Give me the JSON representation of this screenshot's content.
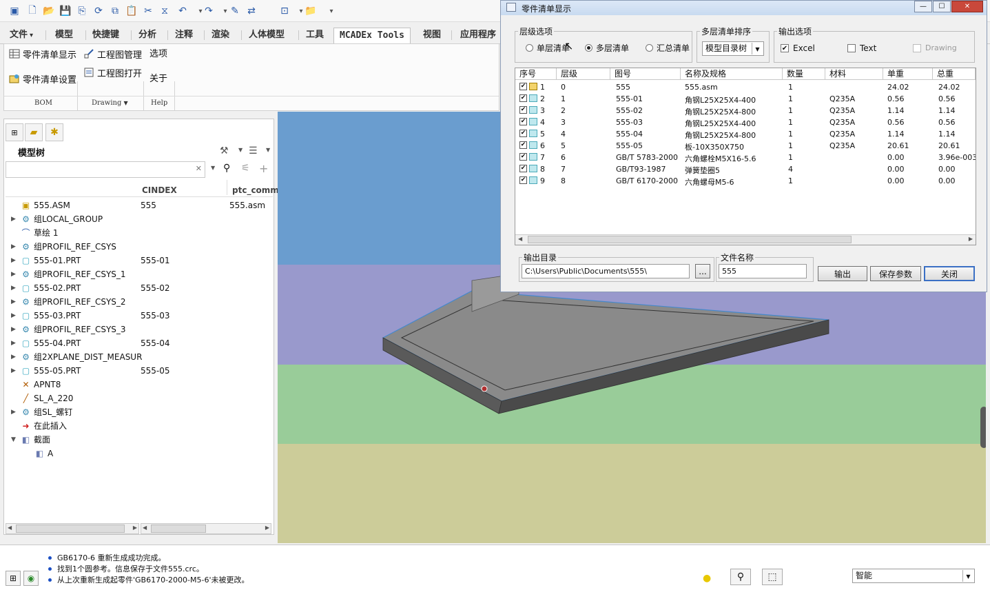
{
  "quick_access": {
    "icons": [
      "app-icon",
      "new-icon",
      "open-icon",
      "save-icon",
      "save-as-icon",
      "regenerate-icon",
      "copy-icon",
      "paste-icon",
      "cut-icon",
      "mirror-icon",
      "undo-icon",
      "undo-dropdown-icon",
      "redo-icon",
      "redo-dropdown-icon",
      "edit-icon",
      "relations-icon",
      "window-icon",
      "window-dropdown-icon",
      "folder-icon",
      "customize-icon"
    ]
  },
  "ribbon": {
    "tabs": [
      "文件",
      "模型",
      "快捷键",
      "分析",
      "注释",
      "渲染",
      "人体模型",
      "工具",
      "MCADEx Tools",
      "视图",
      "应用程序"
    ],
    "file_dropdown": "▾",
    "buttons": {
      "bom_display": "零件清单显示",
      "bom_settings": "零件清单设置",
      "drawing_manage": "工程图管理",
      "drawing_open": "工程图打开",
      "options": "选项",
      "about": "关于"
    },
    "groups": [
      "BOM",
      "Drawing",
      "Help"
    ],
    "group_dropdown": "▼"
  },
  "model_tree": {
    "title": "模型树",
    "search_clear": "✕",
    "columns": [
      "CINDEX",
      "ptc_comm"
    ],
    "items": [
      {
        "name": "555.ASM",
        "c1": "555",
        "c2": "555.asm",
        "arrow": "",
        "icon": "assembly-icon",
        "glyph": "▣",
        "indent": 0
      },
      {
        "name": "组LOCAL_GROUP",
        "c1": "",
        "c2": "",
        "arrow": "▶",
        "icon": "group-icon",
        "glyph": "⚙",
        "indent": 0
      },
      {
        "name": "草绘 1",
        "c1": "",
        "c2": "",
        "arrow": "",
        "icon": "sketch-icon",
        "glyph": "⌒",
        "indent": 0
      },
      {
        "name": "组PROFIL_REF_CSYS",
        "c1": "",
        "c2": "",
        "arrow": "▶",
        "icon": "group-icon",
        "glyph": "⚙",
        "indent": 0
      },
      {
        "name": "555-01.PRT",
        "c1": "555-01",
        "c2": "",
        "arrow": "▶",
        "icon": "part-icon",
        "glyph": "▢",
        "indent": 0
      },
      {
        "name": "组PROFIL_REF_CSYS_1",
        "c1": "",
        "c2": "",
        "arrow": "▶",
        "icon": "group-icon",
        "glyph": "⚙",
        "indent": 0
      },
      {
        "name": "555-02.PRT",
        "c1": "555-02",
        "c2": "",
        "arrow": "▶",
        "icon": "part-icon",
        "glyph": "▢",
        "indent": 0
      },
      {
        "name": "组PROFIL_REF_CSYS_2",
        "c1": "",
        "c2": "",
        "arrow": "▶",
        "icon": "group-icon",
        "glyph": "⚙",
        "indent": 0
      },
      {
        "name": "555-03.PRT",
        "c1": "555-03",
        "c2": "",
        "arrow": "▶",
        "icon": "part-icon",
        "glyph": "▢",
        "indent": 0
      },
      {
        "name": "组PROFIL_REF_CSYS_3",
        "c1": "",
        "c2": "",
        "arrow": "▶",
        "icon": "group-icon",
        "glyph": "⚙",
        "indent": 0
      },
      {
        "name": "555-04.PRT",
        "c1": "555-04",
        "c2": "",
        "arrow": "▶",
        "icon": "part-icon",
        "glyph": "▢",
        "indent": 0
      },
      {
        "name": "组2XPLANE_DIST_MEASUR",
        "c1": "",
        "c2": "",
        "arrow": "▶",
        "icon": "group-icon",
        "glyph": "⚙",
        "indent": 0
      },
      {
        "name": "555-05.PRT",
        "c1": "555-05",
        "c2": "",
        "arrow": "▶",
        "icon": "part-icon",
        "glyph": "▢",
        "indent": 0
      },
      {
        "name": "APNT8",
        "c1": "",
        "c2": "",
        "arrow": "",
        "icon": "datum-point-icon",
        "glyph": "✕",
        "indent": 0
      },
      {
        "name": "SL_A_220",
        "c1": "",
        "c2": "",
        "arrow": "",
        "icon": "datum-curve-icon",
        "glyph": "╱",
        "indent": 0
      },
      {
        "name": "组SL_螺钉",
        "c1": "",
        "c2": "",
        "arrow": "▶",
        "icon": "group-icon",
        "glyph": "⚙",
        "indent": 0
      },
      {
        "name": "在此插入",
        "c1": "",
        "c2": "",
        "arrow": "",
        "icon": "insert-here-icon",
        "glyph": "➜",
        "indent": 0
      },
      {
        "name": "截面",
        "c1": "",
        "c2": "",
        "arrow": "▼",
        "icon": "section-icon",
        "glyph": "◧",
        "indent": 0
      },
      {
        "name": "A",
        "c1": "",
        "c2": "",
        "arrow": "",
        "icon": "section-a-icon",
        "glyph": "◧",
        "indent": 1
      }
    ]
  },
  "dialog": {
    "title": "零件清单显示",
    "level_options": {
      "label": "层级选项",
      "choices": [
        "单层清单",
        "多层清单",
        "汇总清单"
      ],
      "selected": 1
    },
    "multi_sort": {
      "label": "多层清单排序",
      "value": "模型目录树"
    },
    "output_options": {
      "label": "输出选项",
      "choices": [
        {
          "label": "Excel",
          "checked": true,
          "disabled": false
        },
        {
          "label": "Text",
          "checked": false,
          "disabled": false
        },
        {
          "label": "Drawing",
          "checked": false,
          "disabled": true
        }
      ]
    },
    "columns": [
      "序号",
      "层级",
      "图号",
      "名称及规格",
      "数量",
      "材料",
      "单重",
      "总重"
    ],
    "rows": [
      {
        "seq": "1",
        "level": "0",
        "code": "555",
        "name": "555.asm",
        "qty": "1",
        "mat": "",
        "unit": "24.02",
        "total": "24.02",
        "asm": true
      },
      {
        "seq": "2",
        "level": "1",
        "code": "555-01",
        "name": "角钢L25X25X4-400",
        "qty": "1",
        "mat": "Q235A",
        "unit": "0.56",
        "total": "0.56",
        "asm": false
      },
      {
        "seq": "3",
        "level": "2",
        "code": "555-02",
        "name": "角钢L25X25X4-800",
        "qty": "1",
        "mat": "Q235A",
        "unit": "1.14",
        "total": "1.14",
        "asm": false
      },
      {
        "seq": "4",
        "level": "3",
        "code": "555-03",
        "name": "角钢L25X25X4-400",
        "qty": "1",
        "mat": "Q235A",
        "unit": "0.56",
        "total": "0.56",
        "asm": false
      },
      {
        "seq": "5",
        "level": "4",
        "code": "555-04",
        "name": "角钢L25X25X4-800",
        "qty": "1",
        "mat": "Q235A",
        "unit": "1.14",
        "total": "1.14",
        "asm": false
      },
      {
        "seq": "6",
        "level": "5",
        "code": "555-05",
        "name": "板-10X350X750",
        "qty": "1",
        "mat": "Q235A",
        "unit": "20.61",
        "total": "20.61",
        "asm": false
      },
      {
        "seq": "7",
        "level": "6",
        "code": "GB/T 5783-2000",
        "name": "六角螺栓M5X16-5.6",
        "qty": "1",
        "mat": "",
        "unit": "0.00",
        "total": "3.96e-003",
        "asm": false
      },
      {
        "seq": "8",
        "level": "7",
        "code": "GB/T93-1987",
        "name": "弹簧垫圈5",
        "qty": "4",
        "mat": "",
        "unit": "0.00",
        "total": "0.00",
        "asm": false
      },
      {
        "seq": "9",
        "level": "8",
        "code": "GB/T 6170-2000",
        "name": "六角螺母M5-6",
        "qty": "1",
        "mat": "",
        "unit": "0.00",
        "total": "0.00",
        "asm": false
      }
    ],
    "output_dir": {
      "label": "输出目录",
      "value": "C:\\Users\\Public\\Documents\\555\\",
      "browse": "..."
    },
    "file_name": {
      "label": "文件名称",
      "value": "555"
    },
    "buttons": {
      "export": "输出",
      "save_params": "保存参数",
      "close": "关闭"
    },
    "window_buttons": {
      "minimize": "—",
      "maximize": "☐",
      "close": "✕"
    }
  },
  "status": {
    "messages": [
      "GB6170-6 重新生成成功完成。",
      "找到1个圆参考。信息保存于文件555.crc。",
      "从上次重新生成起零件'GB6170-2000-M5-6'未被更改。"
    ],
    "filter_value": "智能"
  },
  "colors": {
    "viewport_sky": "#6a9dcf",
    "viewport_lavender": "#9999cc",
    "viewport_green": "#99cc99",
    "viewport_khaki": "#cccc99",
    "plate_top": "#8a8a8a",
    "plate_edge": "#4488cc",
    "accent": "#2a5aa8"
  }
}
